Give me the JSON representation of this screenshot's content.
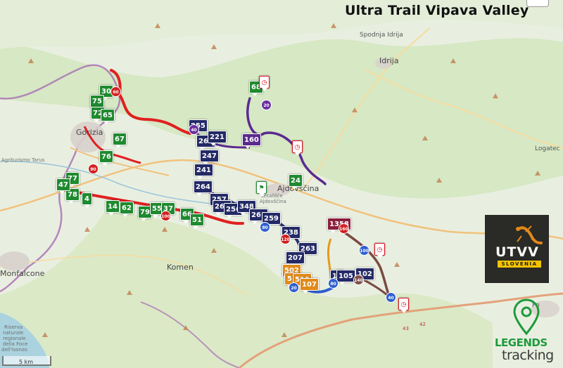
{
  "title": "Ultra Trail Vipava Valley",
  "places": {
    "spodnja_idrija": "Spodnja Idrija",
    "idrija": "Idrija",
    "logatec": "Logatec",
    "gorizia": "Gorizia",
    "agriturismo": "Agriturismo Tarus",
    "ajdovscina": "Ajdovščina",
    "letalisce_1": "Letališče",
    "letalisce_2": "Ajdovščina",
    "komen": "Komen",
    "monfalcone": "Monfalcone",
    "riserva_1": "Riserva",
    "riserva_2": "naturale",
    "riserva_3": "regionale",
    "riserva_4": "della Foce",
    "riserva_5": "dell'Isonzo",
    "pos": "Po"
  },
  "highways": [
    "42",
    "43"
  ],
  "scale": "5 km",
  "logos": {
    "utvv": "UTVV",
    "utvv_sub": "SLOVENIA",
    "legends_1": "LEGENDS",
    "legends_2": "tracking"
  },
  "markers_green": [
    "30",
    "75",
    "72",
    "65",
    "67",
    "76",
    "77",
    "78",
    "47",
    "4",
    "14",
    "62",
    "79",
    "55",
    "37",
    "66",
    "51"
  ],
  "markers_navy": [
    "255",
    "262",
    "221",
    "247",
    "241",
    "264",
    "257",
    "260",
    "256",
    "348",
    "261",
    "259",
    "238",
    "263",
    "207",
    "10",
    "105",
    "102"
  ],
  "markers_purple": [
    "68",
    "160"
  ],
  "markers_orange": [
    "502",
    "5",
    "510",
    "107"
  ],
  "markers_maroon": [
    "1358"
  ],
  "markers_checkpoint": [
    "24"
  ],
  "route_dots": [
    "60",
    "80",
    "40",
    "20",
    "100",
    "160",
    "120",
    "140"
  ],
  "colors": {
    "route_red": "#e02020",
    "route_purple": "#5b2a8f",
    "route_orange": "#e39a1d",
    "route_blue": "#2f5fd0",
    "route_brown": "#7a4a44",
    "marker_green": "#1f8a2f",
    "marker_navy": "#232a66",
    "map_land": "#e9efe0",
    "map_forest": "#cfe3b8",
    "sea": "#aad3df",
    "border": "#a86bb4"
  }
}
